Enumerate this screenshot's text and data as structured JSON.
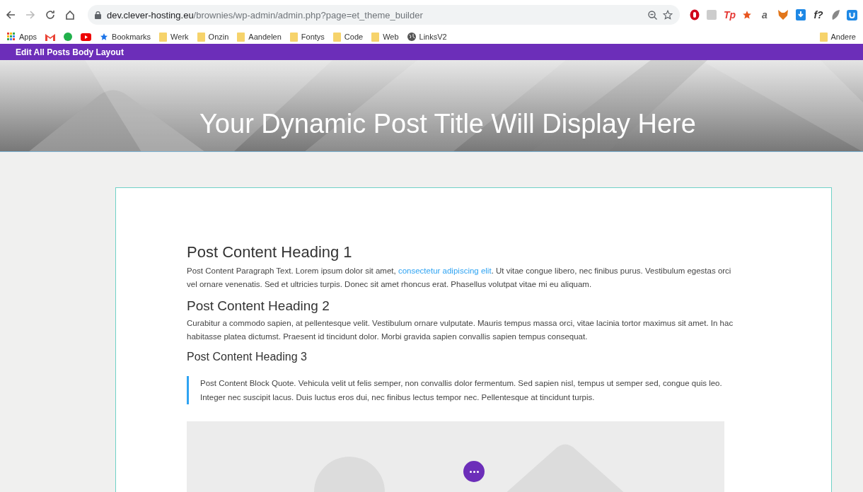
{
  "browser": {
    "url_host": "dev.clever-hosting.eu",
    "url_path": "/brownies/wp-admin/admin.php?page=et_theme_builder",
    "extensions": [
      {
        "kind": "shield"
      },
      {
        "kind": "grey"
      },
      {
        "kind": "glyph",
        "label": "Tp",
        "color": "#e53935"
      },
      {
        "kind": "star"
      },
      {
        "kind": "glyph",
        "label": "a",
        "color": "#666666"
      },
      {
        "kind": "fox"
      },
      {
        "kind": "download"
      },
      {
        "kind": "glyph",
        "label": "f?",
        "color": "#333333"
      },
      {
        "kind": "leaf"
      },
      {
        "kind": "u"
      }
    ]
  },
  "bookmarks": [
    {
      "kind": "apps",
      "label": "Apps"
    },
    {
      "kind": "gmail"
    },
    {
      "kind": "green"
    },
    {
      "kind": "youtube"
    },
    {
      "kind": "star",
      "label": "Bookmarks"
    },
    {
      "kind": "folder",
      "label": "Werk"
    },
    {
      "kind": "folder",
      "label": "Onzin"
    },
    {
      "kind": "folder",
      "label": "Aandelen"
    },
    {
      "kind": "folder",
      "label": "Fontys"
    },
    {
      "kind": "folder",
      "label": "Code"
    },
    {
      "kind": "folder",
      "label": "Web"
    },
    {
      "kind": "globe",
      "label": "LinksV2"
    }
  ],
  "other_bookmarks": "Andere",
  "builder_bar": {
    "title": "Edit All Posts Body Layout"
  },
  "hero": {
    "title": "Your Dynamic Post Title Will Display Here"
  },
  "content": [
    {
      "kind": "h1",
      "text": "Post Content Heading 1"
    },
    {
      "kind": "p",
      "text": "Post Content Paragraph Text. Lorem ipsum dolor sit amet, ",
      "link": "consectetur adipiscing elit",
      "after": ". Ut vitae congue libero, nec finibus purus. Vestibulum egestas orci vel ornare venenatis. Sed et ultricies turpis. Donec sit amet rhoncus erat. Phasellus volutpat vitae mi eu aliquam."
    },
    {
      "kind": "h2",
      "text": "Post Content Heading 2"
    },
    {
      "kind": "p",
      "text": "Curabitur a commodo sapien, at pellentesque velit. Vestibulum ornare vulputate. Mauris tempus massa orci, vitae lacinia tortor maximus sit amet. In hac habitasse platea dictumst. Praesent id tincidunt dolor. Morbi gravida sapien convallis sapien tempus consequat."
    },
    {
      "kind": "h3",
      "text": "Post Content Heading 3"
    },
    {
      "kind": "quote",
      "text": "Post Content Block Quote. Vehicula velit ut felis semper, non convallis dolor fermentum. Sed sapien nisl, tempus ut semper sed, congue quis leo. Integer nec suscipit lacus. Duis luctus eros dui, nec finibus lectus tempor nec. Pellentesque at tincidunt turpis."
    },
    {
      "kind": "image"
    }
  ]
}
